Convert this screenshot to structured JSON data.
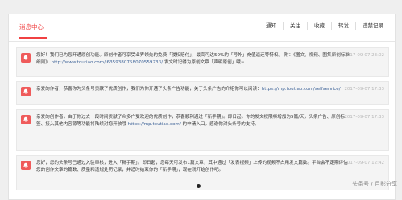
{
  "header": {
    "title": "消息中心",
    "tabs": [
      "通知",
      "关注",
      "收藏",
      "转发",
      "违禁记录"
    ]
  },
  "messages": [
    {
      "text": "您好！我们已为您开通原创功能。原创作者可享受业界领先的免费「侵权赔付」，最高可达50%的「号外」充值返还等特权。 附：《图文、视频、图集原创标准细则》 ",
      "link": "http://www.toutiao.com/i6359380758070559233/",
      "tail": " 发文时记得为原创文章「声明原创」哦~",
      "date": "2017-09-07 23:02"
    },
    {
      "text": "亲爱的作者，恭喜你为头条号贡献了优质创作，我们为你开通了头条广告功能，关于头条广告的介绍你可以阅读：",
      "link": "https://mp.toutiao.com/selfservice/",
      "tail": "",
      "date": "2017-09-07 17:33"
    },
    {
      "text": "亲爱的创作者，由于你过去一段时间贡献了众多广受欢迎的优质创作，恭喜顺利通过「新手期」。即日起，你的发文权限将增加为5篇/天，头条广告、原创标签、接入其他内容源等功能将陆续对您开放哦 ",
      "link": "https://mp.toutiao.com/",
      "tail": " 的申请入口。感谢你对头条号的支持。",
      "date": "2017-09-07 17:33"
    },
    {
      "text": "您好，您的头条号已通过入驻审核，进入「新手期」。即日起，您每天可发布1篇文章，其中通过「发表视频」上传的视频不占用发文篇数。平台会不定期评估您的创作文章的篇数、质量和违规处罚记录，并适时结束你的「新手期」，现在就开始创作吧。",
      "link": "",
      "tail": "",
      "date": "2017-09-07 12:42"
    }
  ],
  "watermark": "头条号 / 月影分享",
  "colors": {
    "accent": "#f04142",
    "link": "#406599",
    "bell": "#ef5b5b"
  },
  "icons": {
    "message": "bell-icon"
  }
}
